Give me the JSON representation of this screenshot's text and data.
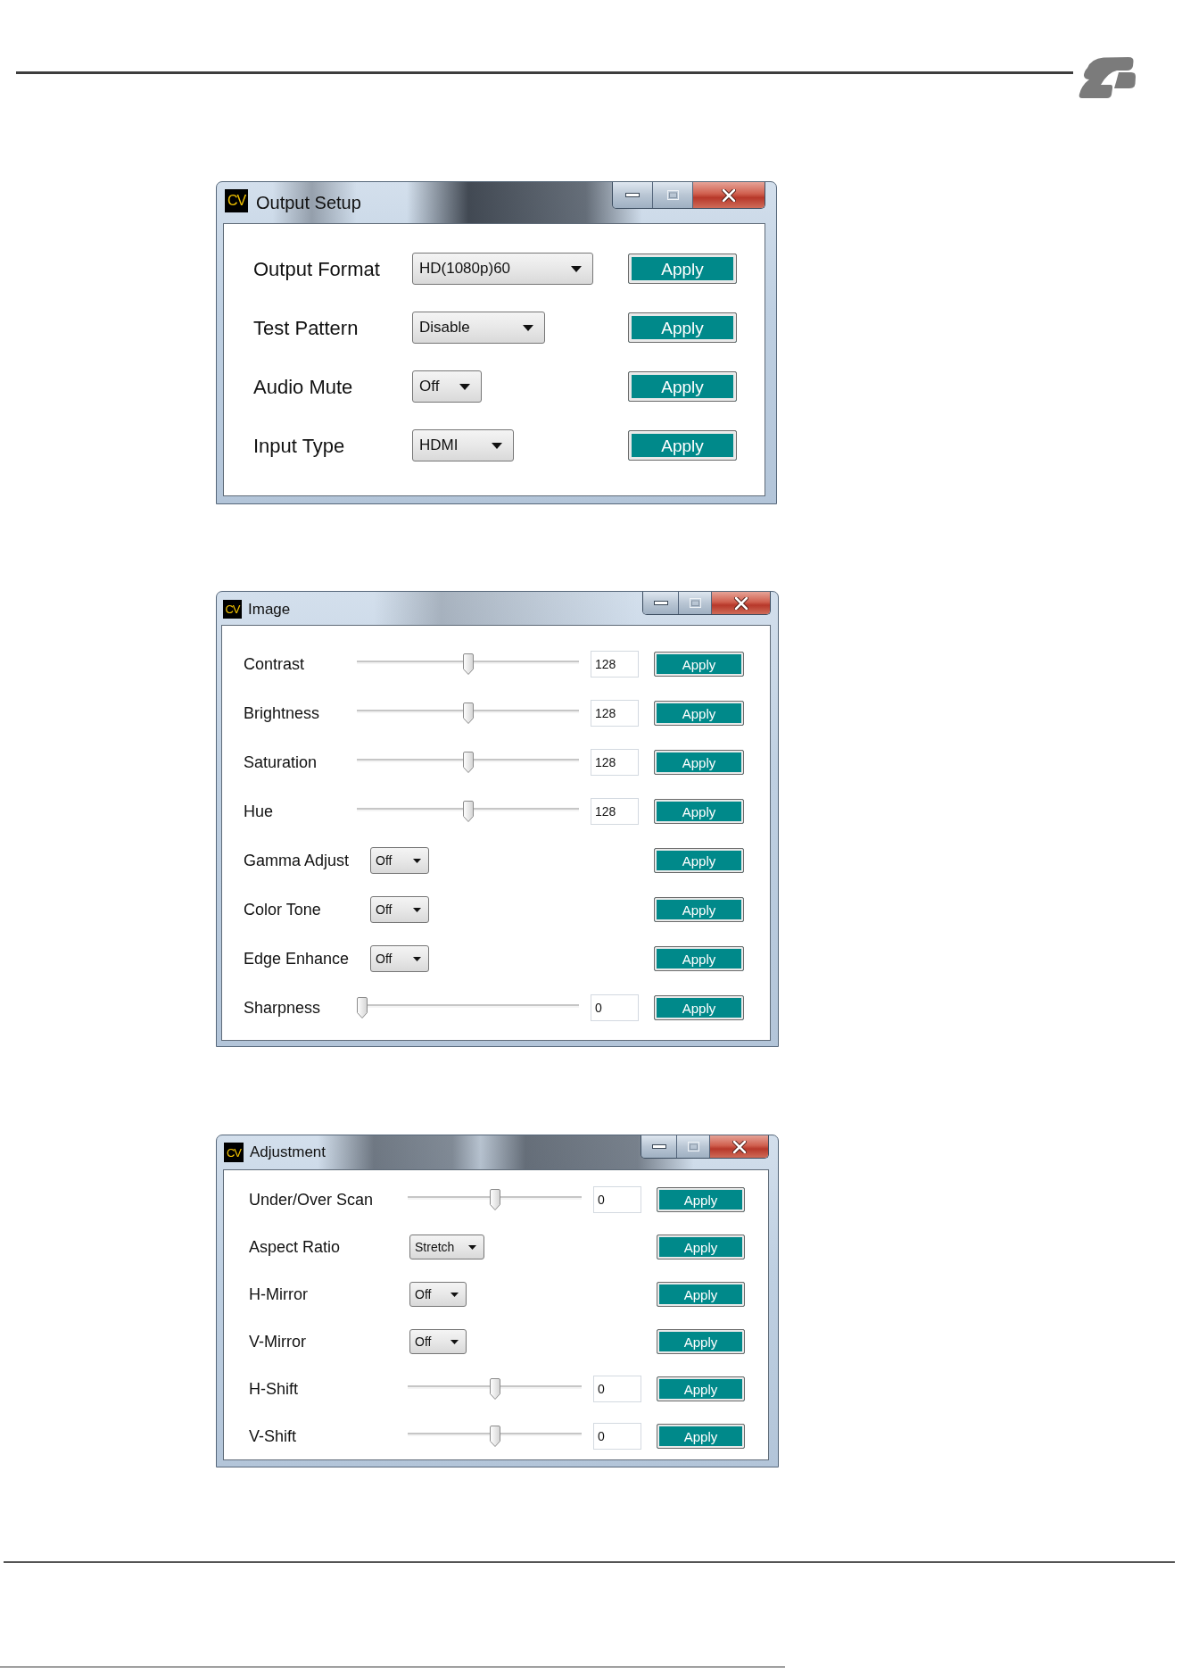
{
  "windows": [
    {
      "app_icon": "CV",
      "title": "Output Setup",
      "rows": [
        {
          "kind": "dropdown",
          "label": "Output Format",
          "value": "HD(1080p)60",
          "button": "Apply"
        },
        {
          "kind": "dropdown",
          "label": "Test Pattern",
          "value": "Disable",
          "button": "Apply"
        },
        {
          "kind": "dropdown",
          "label": "Audio Mute",
          "value": "Off",
          "button": "Apply"
        },
        {
          "kind": "dropdown",
          "label": "Input Type",
          "value": "HDMI",
          "button": "Apply"
        }
      ]
    },
    {
      "app_icon": "CV",
      "title": "Image",
      "rows": [
        {
          "kind": "slider",
          "label": "Contrast",
          "level": 0.5,
          "value": "128",
          "button": "Apply"
        },
        {
          "kind": "slider",
          "label": "Brightness",
          "level": 0.5,
          "value": "128",
          "button": "Apply"
        },
        {
          "kind": "slider",
          "label": "Saturation",
          "level": 0.5,
          "value": "128",
          "button": "Apply"
        },
        {
          "kind": "slider",
          "label": "Hue",
          "level": 0.5,
          "value": "128",
          "button": "Apply"
        },
        {
          "kind": "dropdown",
          "label": "Gamma Adjust",
          "value": "Off",
          "button": "Apply"
        },
        {
          "kind": "dropdown",
          "label": "Color Tone",
          "value": "Off",
          "button": "Apply"
        },
        {
          "kind": "dropdown",
          "label": "Edge Enhance",
          "value": "Off",
          "button": "Apply"
        },
        {
          "kind": "slider",
          "label": "Sharpness",
          "level": 0,
          "value": "0",
          "button": "Apply"
        }
      ]
    },
    {
      "app_icon": "CV",
      "title": "Adjustment",
      "rows": [
        {
          "kind": "slider",
          "label": "Under/Over Scan",
          "level": 0.5,
          "value": "0",
          "button": "Apply"
        },
        {
          "kind": "dropdown",
          "label": "Aspect Ratio",
          "value": "Stretch",
          "button": "Apply"
        },
        {
          "kind": "dropdown",
          "label": "H-Mirror",
          "value": "Off",
          "button": "Apply"
        },
        {
          "kind": "dropdown",
          "label": "V-Mirror",
          "value": "Off",
          "button": "Apply"
        },
        {
          "kind": "slider",
          "label": "H-Shift",
          "level": 0.5,
          "value": "0",
          "button": "Apply"
        },
        {
          "kind": "slider",
          "label": "V-Shift",
          "level": 0.5,
          "value": "0",
          "button": "Apply"
        }
      ]
    }
  ]
}
